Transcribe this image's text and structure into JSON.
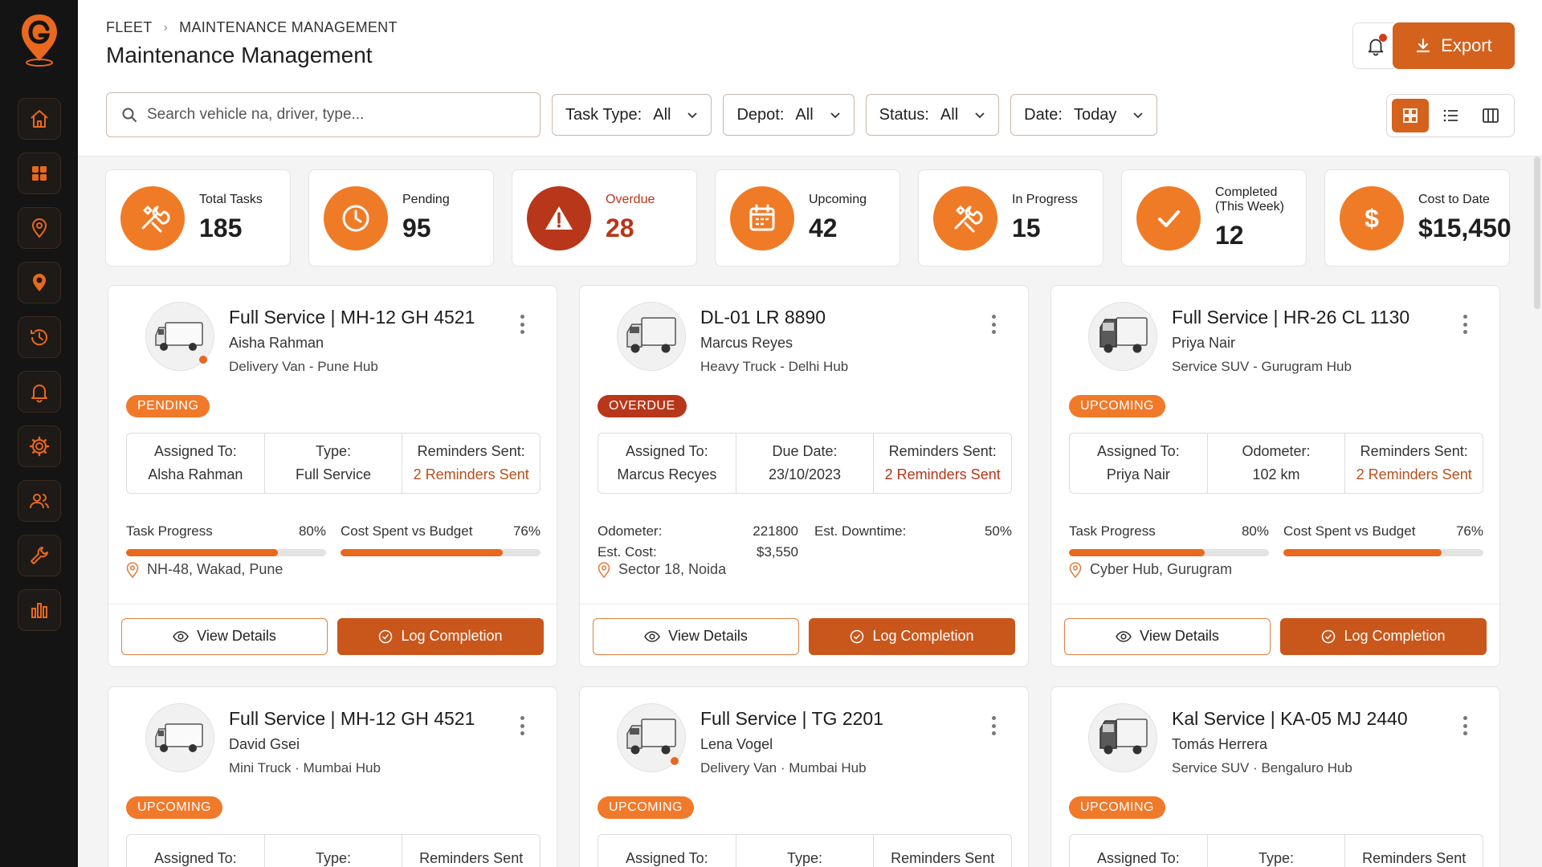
{
  "sidebar": {
    "items": [
      {
        "icon": "home-icon"
      },
      {
        "icon": "dashboard-grid-icon"
      },
      {
        "icon": "location-pin-icon"
      },
      {
        "icon": "route-pin-icon"
      },
      {
        "icon": "history-icon"
      },
      {
        "icon": "bell-icon"
      },
      {
        "icon": "gear-icon"
      },
      {
        "icon": "users-icon"
      },
      {
        "icon": "wrench-icon"
      },
      {
        "icon": "bar-chart-icon"
      }
    ]
  },
  "header": {
    "breadcrumb": [
      "FLEET",
      "MAINTENANCE MANAGEMENT"
    ],
    "title": "Maintenance Management",
    "export_label": "Export"
  },
  "filters": {
    "search_placeholder": "Search vehicle na, driver, type...",
    "task_type": {
      "label": "Task Type:",
      "value": "All"
    },
    "depot": {
      "label": "Depot:",
      "value": "All"
    },
    "status": {
      "label": "Status:",
      "value": "All"
    },
    "date": {
      "label": "Date:",
      "value": "Today"
    }
  },
  "stats": [
    {
      "label": "Total Tasks",
      "value": "185"
    },
    {
      "label": "Pending",
      "value": "95"
    },
    {
      "label": "Overdue",
      "value": "28"
    },
    {
      "label": "Upcoming",
      "value": "42"
    },
    {
      "label": "In Progress",
      "value": "15"
    },
    {
      "label": "Completed\n(This Week)",
      "value": "12"
    },
    {
      "label": "Cost to Date",
      "value": "$15,450"
    }
  ],
  "cards": [
    {
      "title": "Full Service | MH-12 GH 4521",
      "driver": "Aisha Rahman",
      "sub": "Delivery Van - Pune Hub",
      "status": "PENDING",
      "info": [
        {
          "label": "Assigned To:",
          "value": "Alsha Rahman"
        },
        {
          "label": "Type:",
          "value": "Full Service"
        },
        {
          "label": "Reminders Sent:",
          "value": "2 Reminders Sent"
        }
      ],
      "progress": {
        "label": "Task Progress",
        "value": "80%",
        "fraction": 0.76
      },
      "cost": {
        "label": "Cost Spent vs Budget",
        "value": "76%",
        "fraction": 0.81
      },
      "location": "NH-48, Wakad, Pune"
    },
    {
      "title": "DL-01 LR 8890",
      "driver": "Marcus Reyes",
      "sub": "Heavy Truck - Delhi Hub",
      "status": "OVERDUE",
      "info": [
        {
          "label": "Assigned To:",
          "value": "Marcus Recyes"
        },
        {
          "label": "Due Date:",
          "value": "23/10/2023"
        },
        {
          "label": "Reminders Sent:",
          "value": "2 Reminders Sent"
        }
      ],
      "odometer": {
        "label": "Odometer:",
        "value": "221800"
      },
      "est_downtime": {
        "label": "Est. Downtime:",
        "value": "50%"
      },
      "est_cost": {
        "label": "Est. Cost:",
        "value": "$3,550"
      },
      "location": "Sector 18, Noida"
    },
    {
      "title": "Full Service | HR-26 CL 1130",
      "driver": "Priya Nair",
      "sub": "Service SUV - Gurugram Hub",
      "status": "UPCOMING",
      "info": [
        {
          "label": "Assigned To:",
          "value": "Priya Nair"
        },
        {
          "label": "Odometer:",
          "value": "102 km"
        },
        {
          "label": "Reminders Sent:",
          "value": "2 Reminders Sent"
        }
      ],
      "progress": {
        "label": "Task Progress",
        "value": "80%",
        "fraction": 0.68
      },
      "cost": {
        "label": "Cost Spent vs Budget",
        "value": "76%",
        "fraction": 0.79
      },
      "location": "Cyber Hub, Gurugram"
    },
    {
      "title": "Full Service | MH-12 GH 4521",
      "driver": "David Gsei",
      "sub": "Mini Truck · Mumbai Hub",
      "status": "UPCOMING",
      "info": [
        {
          "label": "Assigned To:"
        },
        {
          "label": "Type:"
        },
        {
          "label": "Reminders Sent"
        }
      ]
    },
    {
      "title": "Full Service | TG 2201",
      "driver": "Lena Vogel",
      "sub": "Delivery Van · Mumbai Hub",
      "status": "UPCOMING",
      "info": [
        {
          "label": "Assigned To:"
        },
        {
          "label": "Type:"
        },
        {
          "label": "Reminders Sent"
        }
      ]
    },
    {
      "title": "Kal Service | KA-05 MJ 2440",
      "driver": "Tomás Herrera",
      "sub": "Service SUV · Bengaluro Hub",
      "status": "UPCOMING",
      "info": [
        {
          "label": "Assigned To:"
        },
        {
          "label": "Type:"
        },
        {
          "label": "Reminders Sent"
        }
      ]
    }
  ],
  "actions": {
    "view_label": "View Details",
    "log_label": "Log Completion"
  },
  "colors": {
    "accent": "#e8681e",
    "accent_dark": "#b8361a",
    "sidebar": "#141414"
  }
}
